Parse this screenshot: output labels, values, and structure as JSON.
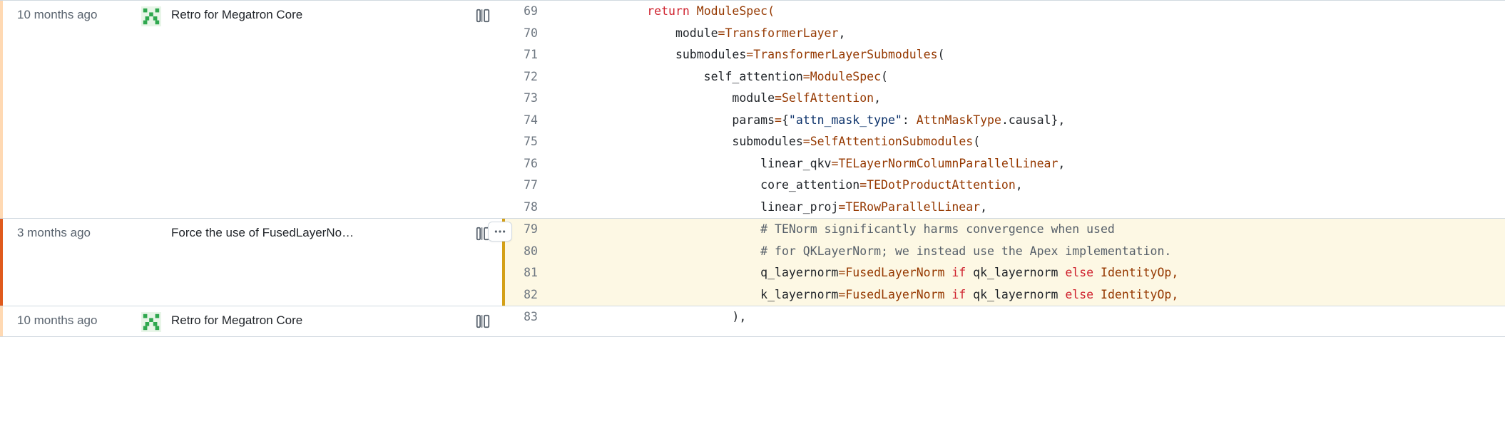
{
  "hunks": [
    {
      "gutter": "light",
      "time": "10 months ago",
      "avatar": true,
      "message": "Retro for Megatron Core",
      "reblame": true,
      "highlight": false,
      "more": false,
      "lines": [
        {
          "no": 69,
          "tokens": [
            [
              "            ",
              ""
            ],
            [
              "return",
              "kw"
            ],
            [
              " ModuleSpec(",
              "fn-call-open",
              "ModuleSpec"
            ]
          ]
        },
        {
          "no": 70,
          "tokens": [
            [
              "                module",
              ""
            ],
            [
              "=",
              "op"
            ],
            [
              "TransformerLayer,",
              "fn",
              "TransformerLayer"
            ]
          ]
        },
        {
          "no": 71,
          "tokens": [
            [
              "                submodules",
              ""
            ],
            [
              "=",
              "op"
            ],
            [
              "TransformerLayerSubmodules(",
              "fn",
              "TransformerLayerSubmodules"
            ]
          ]
        },
        {
          "no": 72,
          "tokens": [
            [
              "                    self_attention",
              ""
            ],
            [
              "=",
              "op"
            ],
            [
              "ModuleSpec(",
              "fn",
              "ModuleSpec"
            ]
          ]
        },
        {
          "no": 73,
          "tokens": [
            [
              "                        module",
              ""
            ],
            [
              "=",
              "op"
            ],
            [
              "SelfAttention,",
              "fn",
              "SelfAttention"
            ]
          ]
        },
        {
          "no": 74,
          "tokens": [
            [
              "                        params",
              ""
            ],
            [
              "=",
              "op"
            ],
            [
              "{",
              ""
            ],
            [
              "\"attn_mask_type\"",
              "str"
            ],
            [
              ": AttnMaskType.causal},",
              "attr",
              "AttnMaskType"
            ]
          ]
        },
        {
          "no": 75,
          "tokens": [
            [
              "                        submodules",
              ""
            ],
            [
              "=",
              "op"
            ],
            [
              "SelfAttentionSubmodules(",
              "fn",
              "SelfAttentionSubmodules"
            ]
          ]
        },
        {
          "no": 76,
          "tokens": [
            [
              "                            linear_qkv",
              ""
            ],
            [
              "=",
              "op"
            ],
            [
              "TELayerNormColumnParallelLinear,",
              "fn",
              "TELayerNormColumnParallelLinear"
            ]
          ]
        },
        {
          "no": 77,
          "tokens": [
            [
              "                            core_attention",
              ""
            ],
            [
              "=",
              "op"
            ],
            [
              "TEDotProductAttention,",
              "fn",
              "TEDotProductAttention"
            ]
          ]
        },
        {
          "no": 78,
          "tokens": [
            [
              "                            linear_proj",
              ""
            ],
            [
              "=",
              "op"
            ],
            [
              "TERowParallelLinear,",
              "fn",
              "TERowParallelLinear"
            ]
          ]
        }
      ]
    },
    {
      "gutter": "dark",
      "time": "3 months ago",
      "avatar": false,
      "message": "Force the use of FusedLayerNo…",
      "reblame": true,
      "highlight": true,
      "more": true,
      "lines": [
        {
          "no": 79,
          "tokens": [
            [
              "                            ",
              ""
            ],
            [
              "# TENorm significantly harms convergence when used",
              "cmt"
            ]
          ]
        },
        {
          "no": 80,
          "tokens": [
            [
              "                            ",
              ""
            ],
            [
              "# for QKLayerNorm; we instead use the Apex implementation.",
              "cmt"
            ]
          ]
        },
        {
          "no": 81,
          "tokens": [
            [
              "                            q_layernorm",
              ""
            ],
            [
              "=",
              "op"
            ],
            [
              "FusedLayerNorm ",
              "fn",
              "FusedLayerNorm"
            ],
            [
              "if",
              "kw"
            ],
            [
              " qk_layernorm ",
              ""
            ],
            [
              "else",
              "kw"
            ],
            [
              " IdentityOp,",
              "fn2",
              "IdentityOp"
            ]
          ]
        },
        {
          "no": 82,
          "tokens": [
            [
              "                            k_layernorm",
              ""
            ],
            [
              "=",
              "op"
            ],
            [
              "FusedLayerNorm ",
              "fn",
              "FusedLayerNorm"
            ],
            [
              "if",
              "kw"
            ],
            [
              " qk_layernorm ",
              ""
            ],
            [
              "else",
              "kw"
            ],
            [
              " IdentityOp,",
              "fn2",
              "IdentityOp"
            ]
          ]
        }
      ]
    },
    {
      "gutter": "light",
      "time": "10 months ago",
      "avatar": true,
      "message": "Retro for Megatron Core",
      "reblame": true,
      "highlight": false,
      "more": false,
      "lines": [
        {
          "no": 83,
          "tokens": [
            [
              "                        ),",
              ""
            ]
          ]
        }
      ]
    }
  ]
}
